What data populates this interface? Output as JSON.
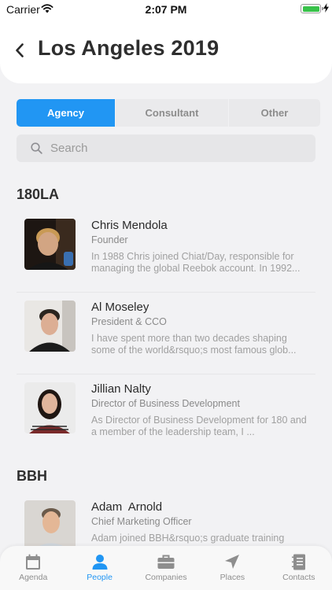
{
  "status_bar": {
    "carrier": "Carrier",
    "time": "2:07 PM",
    "battery_level": 1.0
  },
  "header": {
    "back_icon": "chevron-left-icon",
    "title": "Los Angeles 2019"
  },
  "segments": [
    {
      "label": "Agency",
      "active": true
    },
    {
      "label": "Consultant",
      "active": false
    },
    {
      "label": "Other",
      "active": false
    }
  ],
  "search": {
    "placeholder": "Search",
    "value": "",
    "icon": "search-icon"
  },
  "sections": [
    {
      "title": "180LA",
      "people": [
        {
          "name": "Chris Mendola",
          "role": "Founder",
          "bio": "In 1988 Chris joined Chiat/Day, responsible for managing the global Reebok account. In 1992..."
        },
        {
          "name": "Al Moseley",
          "role": "President & CCO",
          "bio": "I have spent more than two decades shaping some of the world&rsquo;s most famous glob..."
        },
        {
          "name": "Jillian Nalty",
          "role": "Director of Business Development",
          "bio": "As Director of Business Development for 180 and a member of the leadership team, I ..."
        }
      ]
    },
    {
      "title": "BBH",
      "people": [
        {
          "name": "Adam  Arnold",
          "role": "Chief Marketing Officer",
          "bio": "Adam joined BBH&rsquo;s graduate training"
        }
      ]
    }
  ],
  "tabs": [
    {
      "label": "Agenda",
      "icon": "calendar-icon",
      "active": false
    },
    {
      "label": "People",
      "icon": "person-icon",
      "active": true
    },
    {
      "label": "Companies",
      "icon": "briefcase-icon",
      "active": false
    },
    {
      "label": "Places",
      "icon": "navigation-arrow-icon",
      "active": false
    },
    {
      "label": "Contacts",
      "icon": "address-book-icon",
      "active": false
    }
  ],
  "colors": {
    "accent": "#2196f3",
    "background": "#f2f2f4",
    "battery": "#38c24a"
  }
}
